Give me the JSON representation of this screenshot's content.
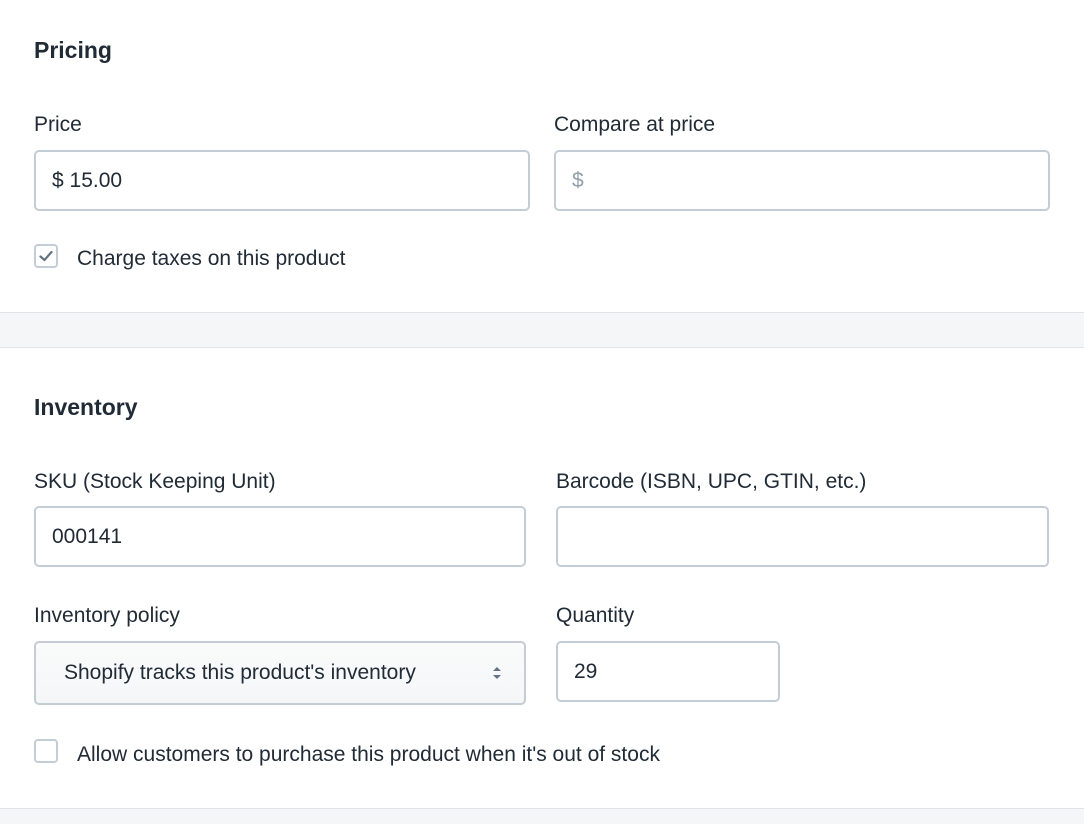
{
  "pricing": {
    "title": "Pricing",
    "price_label": "Price",
    "price_value": "$ 15.00",
    "compare_label": "Compare at price",
    "compare_placeholder": "$",
    "charge_taxes_label": "Charge taxes on this product",
    "charge_taxes_checked": true
  },
  "inventory": {
    "title": "Inventory",
    "sku_label": "SKU (Stock Keeping Unit)",
    "sku_value": "000141",
    "barcode_label": "Barcode (ISBN, UPC, GTIN, etc.)",
    "barcode_value": "",
    "policy_label": "Inventory policy",
    "policy_value": "Shopify tracks this product's inventory",
    "quantity_label": "Quantity",
    "quantity_value": "29",
    "oversell_label": "Allow customers to purchase this product when it's out of stock",
    "oversell_checked": false
  },
  "icons": {
    "checkmark": "checkmark-icon",
    "select_arrows": "select-arrows-icon"
  },
  "colors": {
    "text": "#212b36",
    "border": "#c4cdd5",
    "placeholder": "#919eab",
    "background": "#f4f6f8",
    "card": "#ffffff"
  }
}
